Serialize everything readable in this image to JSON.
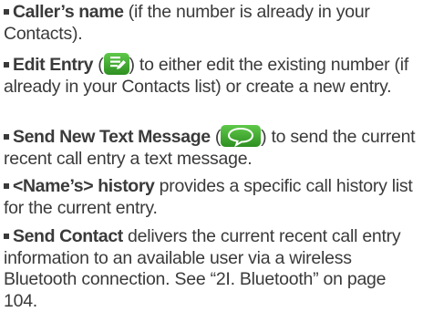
{
  "items": [
    {
      "term": "Caller’s name",
      "text": " (if the number is already in your Contacts)."
    },
    {
      "term": "Edit Entry",
      "pre": " (",
      "post": ") to either edit the existing number (if already in your Contacts list) or create a new entry.",
      "icon": "edit-entry-icon"
    },
    {
      "term": "Send New Text Message",
      "pre": " (",
      "post": ") to send the current recent call entry a text message.",
      "icon": "message-bubble-icon"
    },
    {
      "term": "<Name’s> history",
      "text": " provides a specific call history list for the current entry."
    },
    {
      "term": "Send Contact",
      "text": " delivers the current recent call entry information to an available user via a wireless Bluetooth connection. See “2I. Bluetooth” on page 104."
    }
  ],
  "colors": {
    "text": "#3a3a3a",
    "icon_green": "#3fae2c"
  }
}
